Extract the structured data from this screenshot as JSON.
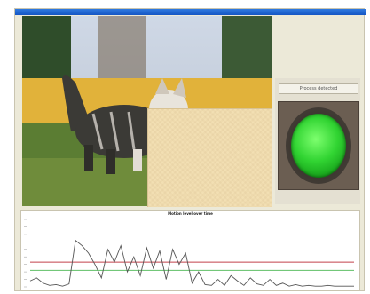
{
  "window": {
    "title_bar_color": "#1f63d0"
  },
  "video": {
    "subject": "kitten photograph"
  },
  "status": {
    "label": "Process detected",
    "lamp_state": "on",
    "lamp_color": "#31d432"
  },
  "chart_data": {
    "type": "line",
    "title": "Motion level over time",
    "x": [
      0,
      1,
      2,
      3,
      4,
      5,
      6,
      7,
      8,
      9,
      10,
      11,
      12,
      13,
      14,
      15,
      16,
      17,
      18,
      19,
      20,
      21,
      22,
      23,
      24,
      25,
      26,
      27,
      28,
      29,
      30,
      31,
      32,
      33,
      34,
      35,
      36,
      37,
      38,
      39,
      40,
      41,
      42,
      43,
      44,
      45,
      46,
      47,
      48,
      49,
      50
    ],
    "series": [
      {
        "values": [
          0.08,
          0.12,
          0.05,
          0.02,
          0.03,
          0.01,
          0.04,
          0.62,
          0.55,
          0.45,
          0.3,
          0.12,
          0.5,
          0.33,
          0.55,
          0.2,
          0.4,
          0.15,
          0.52,
          0.25,
          0.48,
          0.1,
          0.5,
          0.3,
          0.45,
          0.05,
          0.2,
          0.03,
          0.02,
          0.1,
          0.02,
          0.15,
          0.08,
          0.02,
          0.12,
          0.04,
          0.02,
          0.1,
          0.02,
          0.05,
          0.01,
          0.03,
          0.01,
          0.02,
          0.01,
          0.01,
          0.02,
          0.01,
          0.01,
          0.01,
          0.01
        ],
        "color": "#555555"
      }
    ],
    "thresholds": [
      {
        "value": 0.33,
        "color": "#c2404a"
      },
      {
        "value": 0.22,
        "color": "#5fbf66"
      }
    ],
    "ylim": [
      0,
      0.9
    ]
  }
}
